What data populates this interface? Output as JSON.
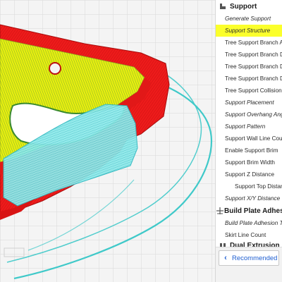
{
  "categories": {
    "support": {
      "label": "Support",
      "icon": "support-icon"
    },
    "build_plate_adhesion": {
      "label": "Build Plate Adhesion",
      "icon": "adhesion-icon"
    },
    "dual_extrusion": {
      "label": "Dual Extrusion",
      "icon": "dual-extrusion-icon"
    }
  },
  "settings": [
    {
      "label": "Generate Support",
      "italic": true
    },
    {
      "label": "Support Structure",
      "italic": true,
      "highlighted": true
    },
    {
      "label": "Tree Support Branch Angle",
      "italic": false
    },
    {
      "label": "Tree Support Branch Distance",
      "italic": false
    },
    {
      "label": "Tree Support Branch Diameter",
      "italic": false
    },
    {
      "label": "Tree Support Branch Diameter Angle",
      "italic": false
    },
    {
      "label": "Tree Support Collision Resolution",
      "italic": false
    },
    {
      "label": "Support Placement",
      "italic": true
    },
    {
      "label": "Support Overhang Angle",
      "italic": true
    },
    {
      "label": "Support Pattern",
      "italic": true
    },
    {
      "label": "Support Wall Line Count",
      "italic": false
    },
    {
      "label": "Enable Support Brim",
      "italic": false
    },
    {
      "label": "Support Brim Width",
      "italic": false
    },
    {
      "label": "Support Z Distance",
      "italic": false
    },
    {
      "label": "Support Top Distance",
      "italic": false,
      "indent": true
    },
    {
      "label": "Support X/Y Distance",
      "italic": true
    }
  ],
  "adhesion_settings": [
    {
      "label": "Build Plate Adhesion Type",
      "italic": true
    },
    {
      "label": "Skirt Line Count",
      "italic": false
    }
  ],
  "footer": {
    "recommended_label": "Recommended",
    "chevron": "‹"
  },
  "colors": {
    "model_red": "#ee1b1b",
    "infill_yellow": "#e8f000",
    "support_cyan": "#6fe3e3",
    "skirt_teal": "#3fc9c9",
    "highlight": "#fbff2c",
    "accent_blue": "#1f5fd1"
  }
}
